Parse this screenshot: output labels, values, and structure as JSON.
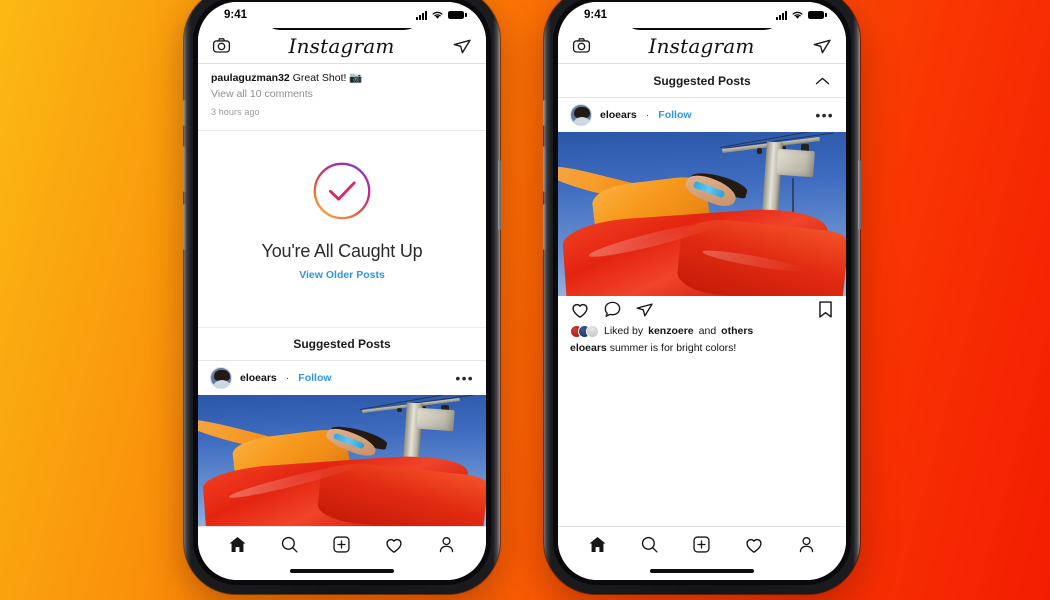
{
  "background": {
    "gradient_from": "#fbb913",
    "gradient_to": "#f31c01"
  },
  "brand": {
    "name": "Instagram",
    "link_color": "#2f95e8",
    "gradient_start": "#8a3ab9",
    "gradient_mid": "#d62976",
    "gradient_end": "#f9a03f"
  },
  "phones": [
    {
      "id": "phone-left",
      "status_bar": {
        "time": "9:41",
        "signal_icon": "cellular-bars-icon",
        "wifi_icon": "wifi-icon",
        "battery_icon": "battery-icon"
      },
      "nav": {
        "camera_icon": "camera-icon",
        "title": "Instagram",
        "direct_icon": "send-paper-plane-icon"
      },
      "previous_post": {
        "username": "paulaguzman32",
        "comment": "Great Shot!",
        "comment_emoji": "📷",
        "view_comments": "View all 10 comments",
        "timestamp": "3 hours ago"
      },
      "caught_up": {
        "check_icon": "check-circle-gradient-icon",
        "title": "You're All Caught Up",
        "link": "View Older Posts"
      },
      "suggested": {
        "header": "Suggested Posts",
        "collapse_icon": null
      },
      "post": {
        "avatar": "user-avatar",
        "username": "eloears",
        "separator": "·",
        "follow_label": "Follow",
        "more_icon": "more-options-icon"
      },
      "tabbar": {
        "items": [
          {
            "icon": "home-icon",
            "label": "Home",
            "active": true
          },
          {
            "icon": "search-icon",
            "label": "Search",
            "active": false
          },
          {
            "icon": "add-post-icon",
            "label": "Create",
            "active": false
          },
          {
            "icon": "heart-icon",
            "label": "Activity",
            "active": false
          },
          {
            "icon": "profile-icon",
            "label": "Profile",
            "active": false
          }
        ]
      }
    },
    {
      "id": "phone-right",
      "status_bar": {
        "time": "9:41",
        "signal_icon": "cellular-bars-icon",
        "wifi_icon": "wifi-icon",
        "battery_icon": "battery-icon"
      },
      "nav": {
        "camera_icon": "camera-icon",
        "title": "Instagram",
        "direct_icon": "send-paper-plane-icon"
      },
      "suggested": {
        "header": "Suggested Posts",
        "collapse_icon": "chevron-up-icon"
      },
      "post": {
        "avatar": "user-avatar",
        "username": "eloears",
        "separator": "·",
        "follow_label": "Follow",
        "more_icon": "more-options-icon",
        "photo_alt": "person-in-orange-shirt-and-red-pants-under-utility-pole",
        "actions": {
          "like_icon": "heart-icon",
          "comment_icon": "comment-bubble-icon",
          "share_icon": "send-paper-plane-icon",
          "save_icon": "bookmark-icon"
        },
        "likes": {
          "prefix": "Liked by",
          "username": "kenzoere",
          "middle": "and",
          "suffix": "others"
        },
        "caption": {
          "username": "eloears",
          "text": "summer is for bright colors!"
        }
      },
      "tabbar": {
        "items": [
          {
            "icon": "home-icon",
            "label": "Home",
            "active": true
          },
          {
            "icon": "search-icon",
            "label": "Search",
            "active": false
          },
          {
            "icon": "add-post-icon",
            "label": "Create",
            "active": false
          },
          {
            "icon": "heart-icon",
            "label": "Activity",
            "active": false
          },
          {
            "icon": "profile-icon",
            "label": "Profile",
            "active": false
          }
        ]
      }
    }
  ]
}
